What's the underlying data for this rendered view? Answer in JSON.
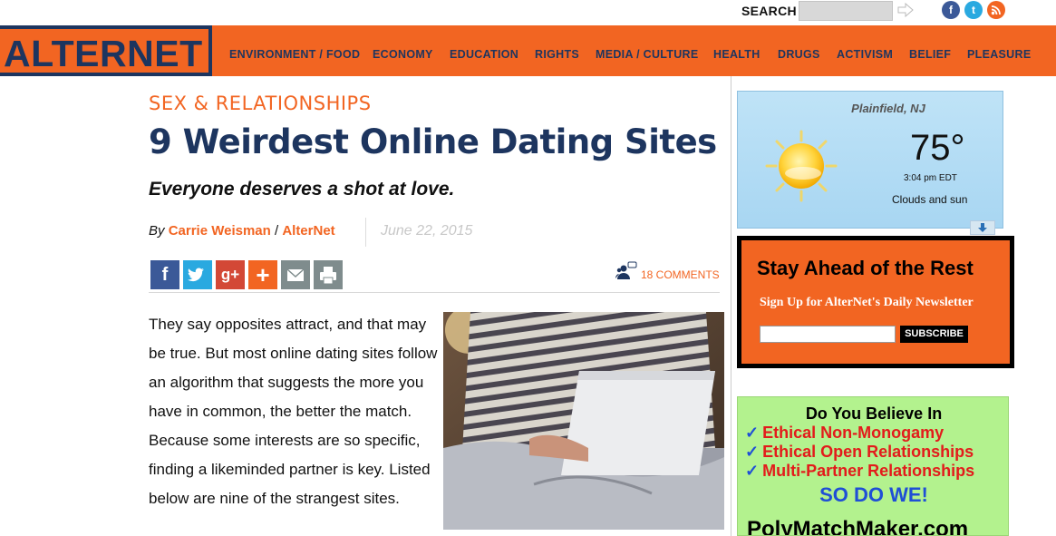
{
  "header": {
    "search_label": "SEARCH",
    "search_placeholder": "",
    "social": [
      "f",
      "t",
      "rss"
    ]
  },
  "logo": "ALTERNET",
  "nav": [
    "ENVIRONMENT / FOOD",
    "ECONOMY",
    "EDUCATION",
    "RIGHTS",
    "MEDIA / CULTURE",
    "HEALTH",
    "DRUGS",
    "ACTIVISM",
    "BELIEF",
    "PLEASURE"
  ],
  "article": {
    "kicker": "SEX & RELATIONSHIPS",
    "title": "9 Weirdest Online Dating Sites",
    "dek": "Everyone deserves a shot at love.",
    "by": "By ",
    "author": "Carrie Weisman",
    "sep": " / ",
    "publication": "AlterNet",
    "date": "June 22, 2015",
    "comments": "18 COMMENTS",
    "body": "They say opposites attract, and that may be true. But most online dating sites follow an algorithm that suggests the more you have in common, the better the match. Because some interests are so specific, finding a likeminded partner is key. Listed below are nine of the strangest sites."
  },
  "share": [
    {
      "icon": "facebook-icon",
      "glyph": "f",
      "color": "#3b5998"
    },
    {
      "icon": "twitter-icon",
      "glyph": "t",
      "color": "#2aa9e0"
    },
    {
      "icon": "google-plus-icon",
      "glyph": "g+",
      "color": "#d34836"
    },
    {
      "icon": "add-icon",
      "glyph": "+",
      "color": "#f26522"
    },
    {
      "icon": "email-icon",
      "glyph": "✉",
      "color": "#7f8c8d"
    },
    {
      "icon": "print-icon",
      "glyph": "⎙",
      "color": "#7f8c8d"
    }
  ],
  "weather": {
    "city": "Plainfield, NJ",
    "temp": "75°",
    "time": "3:04 pm EDT",
    "condition": "Clouds and sun"
  },
  "newsletter": {
    "title": "Stay Ahead of the Rest",
    "subtitle": "Sign Up for AlterNet's Daily Newsletter",
    "button": "SUBSCRIBE"
  },
  "ad": {
    "heading": "Do You Believe In",
    "items": [
      "Ethical Non-Monogamy",
      "Ethical Open Relationships",
      "Multi-Partner Relationships"
    ],
    "tagline": "SO DO WE!",
    "brand": "PolyMatchMaker.com"
  },
  "colors": {
    "accent": "#f26522",
    "navy": "#1d355f"
  }
}
